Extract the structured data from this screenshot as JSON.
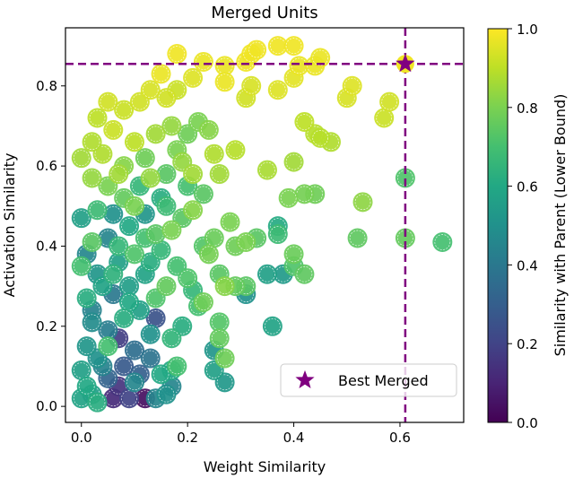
{
  "chart_data": {
    "type": "scatter",
    "title": "Merged Units",
    "xlabel": "Weight Similarity",
    "ylabel": "Activation Similarity",
    "xlim": [
      -0.03,
      0.72
    ],
    "ylim": [
      -0.04,
      0.945
    ],
    "xticks": [
      0.0,
      0.2,
      0.4,
      0.6
    ],
    "xtick_labels": [
      "0.0",
      "0.2",
      "0.4",
      "0.6"
    ],
    "yticks": [
      0.0,
      0.2,
      0.4,
      0.6,
      0.8
    ],
    "ytick_labels": [
      "0.0",
      "0.2",
      "0.4",
      "0.6",
      "0.8"
    ],
    "grid": false,
    "colorbar": {
      "label": "Similarity with Parent (Lower Bound)",
      "colormap": "viridis",
      "range": [
        0.0,
        1.0
      ],
      "ticks": [
        0.0,
        0.2,
        0.4,
        0.6,
        0.8,
        1.0
      ],
      "tick_labels": [
        "0.0",
        "0.2",
        "0.4",
        "0.6",
        "0.8",
        "1.0"
      ]
    },
    "reference_lines": {
      "vertical_x": 0.61,
      "horizontal_y": 0.855,
      "color": "#800080",
      "style": "dashed"
    },
    "best_point": {
      "x": 0.61,
      "y": 0.855,
      "label": "Best Merged",
      "marker": "star",
      "color": "#800080"
    },
    "legend": {
      "entries": [
        "Best Merged"
      ],
      "placement": "lower-right"
    },
    "points": [
      {
        "x": 0.15,
        "y": 0.83,
        "c": 0.97
      },
      {
        "x": 0.18,
        "y": 0.88,
        "c": 0.98
      },
      {
        "x": 0.23,
        "y": 0.86,
        "c": 0.97
      },
      {
        "x": 0.27,
        "y": 0.85,
        "c": 0.97
      },
      {
        "x": 0.27,
        "y": 0.81,
        "c": 0.97
      },
      {
        "x": 0.31,
        "y": 0.86,
        "c": 0.98
      },
      {
        "x": 0.32,
        "y": 0.88,
        "c": 0.98
      },
      {
        "x": 0.33,
        "y": 0.89,
        "c": 0.98
      },
      {
        "x": 0.37,
        "y": 0.9,
        "c": 0.98
      },
      {
        "x": 0.4,
        "y": 0.9,
        "c": 0.98
      },
      {
        "x": 0.41,
        "y": 0.85,
        "c": 0.97
      },
      {
        "x": 0.44,
        "y": 0.85,
        "c": 0.97
      },
      {
        "x": 0.45,
        "y": 0.87,
        "c": 0.97
      },
      {
        "x": 0.4,
        "y": 0.82,
        "c": 0.96
      },
      {
        "x": 0.37,
        "y": 0.79,
        "c": 0.95
      },
      {
        "x": 0.32,
        "y": 0.8,
        "c": 0.94
      },
      {
        "x": 0.31,
        "y": 0.77,
        "c": 0.93
      },
      {
        "x": 0.51,
        "y": 0.8,
        "c": 0.95
      },
      {
        "x": 0.5,
        "y": 0.77,
        "c": 0.94
      },
      {
        "x": 0.58,
        "y": 0.76,
        "c": 0.93
      },
      {
        "x": 0.57,
        "y": 0.72,
        "c": 0.92
      },
      {
        "x": 0.42,
        "y": 0.71,
        "c": 0.9
      },
      {
        "x": 0.44,
        "y": 0.68,
        "c": 0.89
      },
      {
        "x": 0.47,
        "y": 0.66,
        "c": 0.88
      },
      {
        "x": 0.45,
        "y": 0.67,
        "c": 0.89
      },
      {
        "x": 0.4,
        "y": 0.61,
        "c": 0.86
      },
      {
        "x": 0.35,
        "y": 0.59,
        "c": 0.87
      },
      {
        "x": 0.26,
        "y": 0.58,
        "c": 0.86
      },
      {
        "x": 0.29,
        "y": 0.64,
        "c": 0.89
      },
      {
        "x": 0.25,
        "y": 0.63,
        "c": 0.88
      },
      {
        "x": 0.21,
        "y": 0.58,
        "c": 0.86
      },
      {
        "x": 0.19,
        "y": 0.61,
        "c": 0.84
      },
      {
        "x": 0.39,
        "y": 0.52,
        "c": 0.8
      },
      {
        "x": 0.42,
        "y": 0.53,
        "c": 0.79
      },
      {
        "x": 0.44,
        "y": 0.53,
        "c": 0.78
      },
      {
        "x": 0.53,
        "y": 0.51,
        "c": 0.83
      },
      {
        "x": 0.61,
        "y": 0.57,
        "c": 0.72
      },
      {
        "x": 0.61,
        "y": 0.42,
        "c": 0.76
      },
      {
        "x": 0.68,
        "y": 0.41,
        "c": 0.7
      },
      {
        "x": 0.52,
        "y": 0.42,
        "c": 0.75
      },
      {
        "x": 0.37,
        "y": 0.45,
        "c": 0.61
      },
      {
        "x": 0.37,
        "y": 0.43,
        "c": 0.68
      },
      {
        "x": 0.33,
        "y": 0.42,
        "c": 0.74
      },
      {
        "x": 0.31,
        "y": 0.41,
        "c": 0.8
      },
      {
        "x": 0.29,
        "y": 0.4,
        "c": 0.78
      },
      {
        "x": 0.28,
        "y": 0.46,
        "c": 0.8
      },
      {
        "x": 0.4,
        "y": 0.38,
        "c": 0.77
      },
      {
        "x": 0.4,
        "y": 0.35,
        "c": 0.72
      },
      {
        "x": 0.35,
        "y": 0.33,
        "c": 0.56
      },
      {
        "x": 0.38,
        "y": 0.33,
        "c": 0.54
      },
      {
        "x": 0.42,
        "y": 0.33,
        "c": 0.75
      },
      {
        "x": 0.31,
        "y": 0.3,
        "c": 0.74
      },
      {
        "x": 0.31,
        "y": 0.28,
        "c": 0.5
      },
      {
        "x": 0.36,
        "y": 0.2,
        "c": 0.58
      },
      {
        "x": 0.23,
        "y": 0.4,
        "c": 0.73
      },
      {
        "x": 0.25,
        "y": 0.42,
        "c": 0.77
      },
      {
        "x": 0.24,
        "y": 0.38,
        "c": 0.79
      },
      {
        "x": 0.26,
        "y": 0.33,
        "c": 0.74
      },
      {
        "x": 0.27,
        "y": 0.3,
        "c": 0.82
      },
      {
        "x": 0.23,
        "y": 0.26,
        "c": 0.78
      },
      {
        "x": 0.29,
        "y": 0.3,
        "c": 0.76
      },
      {
        "x": 0.26,
        "y": 0.21,
        "c": 0.73
      },
      {
        "x": 0.26,
        "y": 0.17,
        "c": 0.76
      },
      {
        "x": 0.25,
        "y": 0.14,
        "c": 0.52
      },
      {
        "x": 0.27,
        "y": 0.12,
        "c": 0.78
      },
      {
        "x": 0.25,
        "y": 0.09,
        "c": 0.56
      },
      {
        "x": 0.27,
        "y": 0.06,
        "c": 0.53
      },
      {
        "x": 0.22,
        "y": 0.25,
        "c": 0.7
      },
      {
        "x": 0.21,
        "y": 0.29,
        "c": 0.66
      },
      {
        "x": 0.2,
        "y": 0.32,
        "c": 0.72
      },
      {
        "x": 0.19,
        "y": 0.2,
        "c": 0.62
      },
      {
        "x": 0.17,
        "y": 0.17,
        "c": 0.65
      },
      {
        "x": 0.18,
        "y": 0.1,
        "c": 0.7
      },
      {
        "x": 0.17,
        "y": 0.09,
        "c": 0.6
      },
      {
        "x": 0.17,
        "y": 0.05,
        "c": 0.45
      },
      {
        "x": 0.16,
        "y": 0.03,
        "c": 0.5
      },
      {
        "x": 0.14,
        "y": 0.02,
        "c": 0.45
      },
      {
        "x": 0.12,
        "y": 0.02,
        "c": 0.04
      },
      {
        "x": 0.14,
        "y": 0.22,
        "c": 0.25
      },
      {
        "x": 0.13,
        "y": 0.12,
        "c": 0.38
      },
      {
        "x": 0.11,
        "y": 0.08,
        "c": 0.3
      },
      {
        "x": 0.09,
        "y": 0.02,
        "c": 0.2
      },
      {
        "x": 0.06,
        "y": 0.02,
        "c": 0.12
      },
      {
        "x": 0.07,
        "y": 0.05,
        "c": 0.15
      },
      {
        "x": 0.05,
        "y": 0.07,
        "c": 0.32
      },
      {
        "x": 0.08,
        "y": 0.1,
        "c": 0.28
      },
      {
        "x": 0.07,
        "y": 0.17,
        "c": 0.18
      },
      {
        "x": 0.1,
        "y": 0.14,
        "c": 0.36
      },
      {
        "x": 0.05,
        "y": 0.19,
        "c": 0.42
      },
      {
        "x": 0.03,
        "y": 0.12,
        "c": 0.5
      },
      {
        "x": 0.02,
        "y": 0.03,
        "c": 0.55
      },
      {
        "x": 0.01,
        "y": 0.05,
        "c": 0.6
      },
      {
        "x": 0.0,
        "y": 0.02,
        "c": 0.58
      },
      {
        "x": 0.02,
        "y": 0.21,
        "c": 0.48
      },
      {
        "x": 0.01,
        "y": 0.27,
        "c": 0.62
      },
      {
        "x": 0.03,
        "y": 0.33,
        "c": 0.52
      },
      {
        "x": 0.0,
        "y": 0.35,
        "c": 0.7
      },
      {
        "x": 0.02,
        "y": 0.41,
        "c": 0.74
      },
      {
        "x": 0.0,
        "y": 0.47,
        "c": 0.56
      },
      {
        "x": 0.03,
        "y": 0.49,
        "c": 0.68
      },
      {
        "x": 0.05,
        "y": 0.42,
        "c": 0.45
      },
      {
        "x": 0.07,
        "y": 0.36,
        "c": 0.56
      },
      {
        "x": 0.09,
        "y": 0.3,
        "c": 0.55
      },
      {
        "x": 0.06,
        "y": 0.28,
        "c": 0.4
      },
      {
        "x": 0.1,
        "y": 0.38,
        "c": 0.72
      },
      {
        "x": 0.12,
        "y": 0.33,
        "c": 0.58
      },
      {
        "x": 0.14,
        "y": 0.43,
        "c": 0.74
      },
      {
        "x": 0.12,
        "y": 0.48,
        "c": 0.52
      },
      {
        "x": 0.15,
        "y": 0.39,
        "c": 0.66
      },
      {
        "x": 0.16,
        "y": 0.3,
        "c": 0.76
      },
      {
        "x": 0.18,
        "y": 0.35,
        "c": 0.7
      },
      {
        "x": 0.17,
        "y": 0.44,
        "c": 0.8
      },
      {
        "x": 0.19,
        "y": 0.47,
        "c": 0.74
      },
      {
        "x": 0.15,
        "y": 0.52,
        "c": 0.62
      },
      {
        "x": 0.11,
        "y": 0.55,
        "c": 0.66
      },
      {
        "x": 0.08,
        "y": 0.52,
        "c": 0.76
      },
      {
        "x": 0.05,
        "y": 0.55,
        "c": 0.8
      },
      {
        "x": 0.02,
        "y": 0.57,
        "c": 0.84
      },
      {
        "x": 0.0,
        "y": 0.62,
        "c": 0.86
      },
      {
        "x": 0.04,
        "y": 0.63,
        "c": 0.88
      },
      {
        "x": 0.08,
        "y": 0.6,
        "c": 0.82
      },
      {
        "x": 0.12,
        "y": 0.62,
        "c": 0.78
      },
      {
        "x": 0.16,
        "y": 0.58,
        "c": 0.74
      },
      {
        "x": 0.18,
        "y": 0.64,
        "c": 0.8
      },
      {
        "x": 0.17,
        "y": 0.7,
        "c": 0.84
      },
      {
        "x": 0.14,
        "y": 0.68,
        "c": 0.86
      },
      {
        "x": 0.1,
        "y": 0.66,
        "c": 0.9
      },
      {
        "x": 0.06,
        "y": 0.69,
        "c": 0.92
      },
      {
        "x": 0.03,
        "y": 0.72,
        "c": 0.9
      },
      {
        "x": 0.02,
        "y": 0.66,
        "c": 0.88
      },
      {
        "x": 0.05,
        "y": 0.76,
        "c": 0.93
      },
      {
        "x": 0.08,
        "y": 0.74,
        "c": 0.92
      },
      {
        "x": 0.11,
        "y": 0.76,
        "c": 0.93
      },
      {
        "x": 0.13,
        "y": 0.79,
        "c": 0.94
      },
      {
        "x": 0.16,
        "y": 0.77,
        "c": 0.93
      },
      {
        "x": 0.18,
        "y": 0.79,
        "c": 0.92
      },
      {
        "x": 0.21,
        "y": 0.82,
        "c": 0.95
      },
      {
        "x": 0.22,
        "y": 0.71,
        "c": 0.8
      },
      {
        "x": 0.2,
        "y": 0.68,
        "c": 0.78
      },
      {
        "x": 0.24,
        "y": 0.69,
        "c": 0.82
      },
      {
        "x": 0.23,
        "y": 0.53,
        "c": 0.74
      },
      {
        "x": 0.2,
        "y": 0.55,
        "c": 0.7
      },
      {
        "x": 0.21,
        "y": 0.49,
        "c": 0.82
      },
      {
        "x": 0.09,
        "y": 0.45,
        "c": 0.6
      },
      {
        "x": 0.07,
        "y": 0.4,
        "c": 0.66
      },
      {
        "x": 0.04,
        "y": 0.3,
        "c": 0.58
      },
      {
        "x": 0.08,
        "y": 0.22,
        "c": 0.62
      },
      {
        "x": 0.11,
        "y": 0.24,
        "c": 0.56
      },
      {
        "x": 0.13,
        "y": 0.18,
        "c": 0.5
      },
      {
        "x": 0.1,
        "y": 0.06,
        "c": 0.46
      },
      {
        "x": 0.04,
        "y": 0.1,
        "c": 0.44
      },
      {
        "x": 0.01,
        "y": 0.15,
        "c": 0.52
      },
      {
        "x": 0.0,
        "y": 0.09,
        "c": 0.56
      },
      {
        "x": 0.03,
        "y": 0.01,
        "c": 0.62
      },
      {
        "x": 0.05,
        "y": 0.15,
        "c": 0.7
      },
      {
        "x": 0.15,
        "y": 0.08,
        "c": 0.6
      },
      {
        "x": 0.14,
        "y": 0.27,
        "c": 0.72
      },
      {
        "x": 0.13,
        "y": 0.36,
        "c": 0.62
      },
      {
        "x": 0.16,
        "y": 0.5,
        "c": 0.68
      },
      {
        "x": 0.06,
        "y": 0.48,
        "c": 0.5
      },
      {
        "x": 0.01,
        "y": 0.38,
        "c": 0.46
      },
      {
        "x": 0.02,
        "y": 0.24,
        "c": 0.44
      },
      {
        "x": 0.06,
        "y": 0.33,
        "c": 0.64
      },
      {
        "x": 0.09,
        "y": 0.26,
        "c": 0.6
      },
      {
        "x": 0.12,
        "y": 0.42,
        "c": 0.7
      },
      {
        "x": 0.1,
        "y": 0.5,
        "c": 0.8
      },
      {
        "x": 0.07,
        "y": 0.58,
        "c": 0.86
      },
      {
        "x": 0.13,
        "y": 0.57,
        "c": 0.84
      }
    ]
  }
}
